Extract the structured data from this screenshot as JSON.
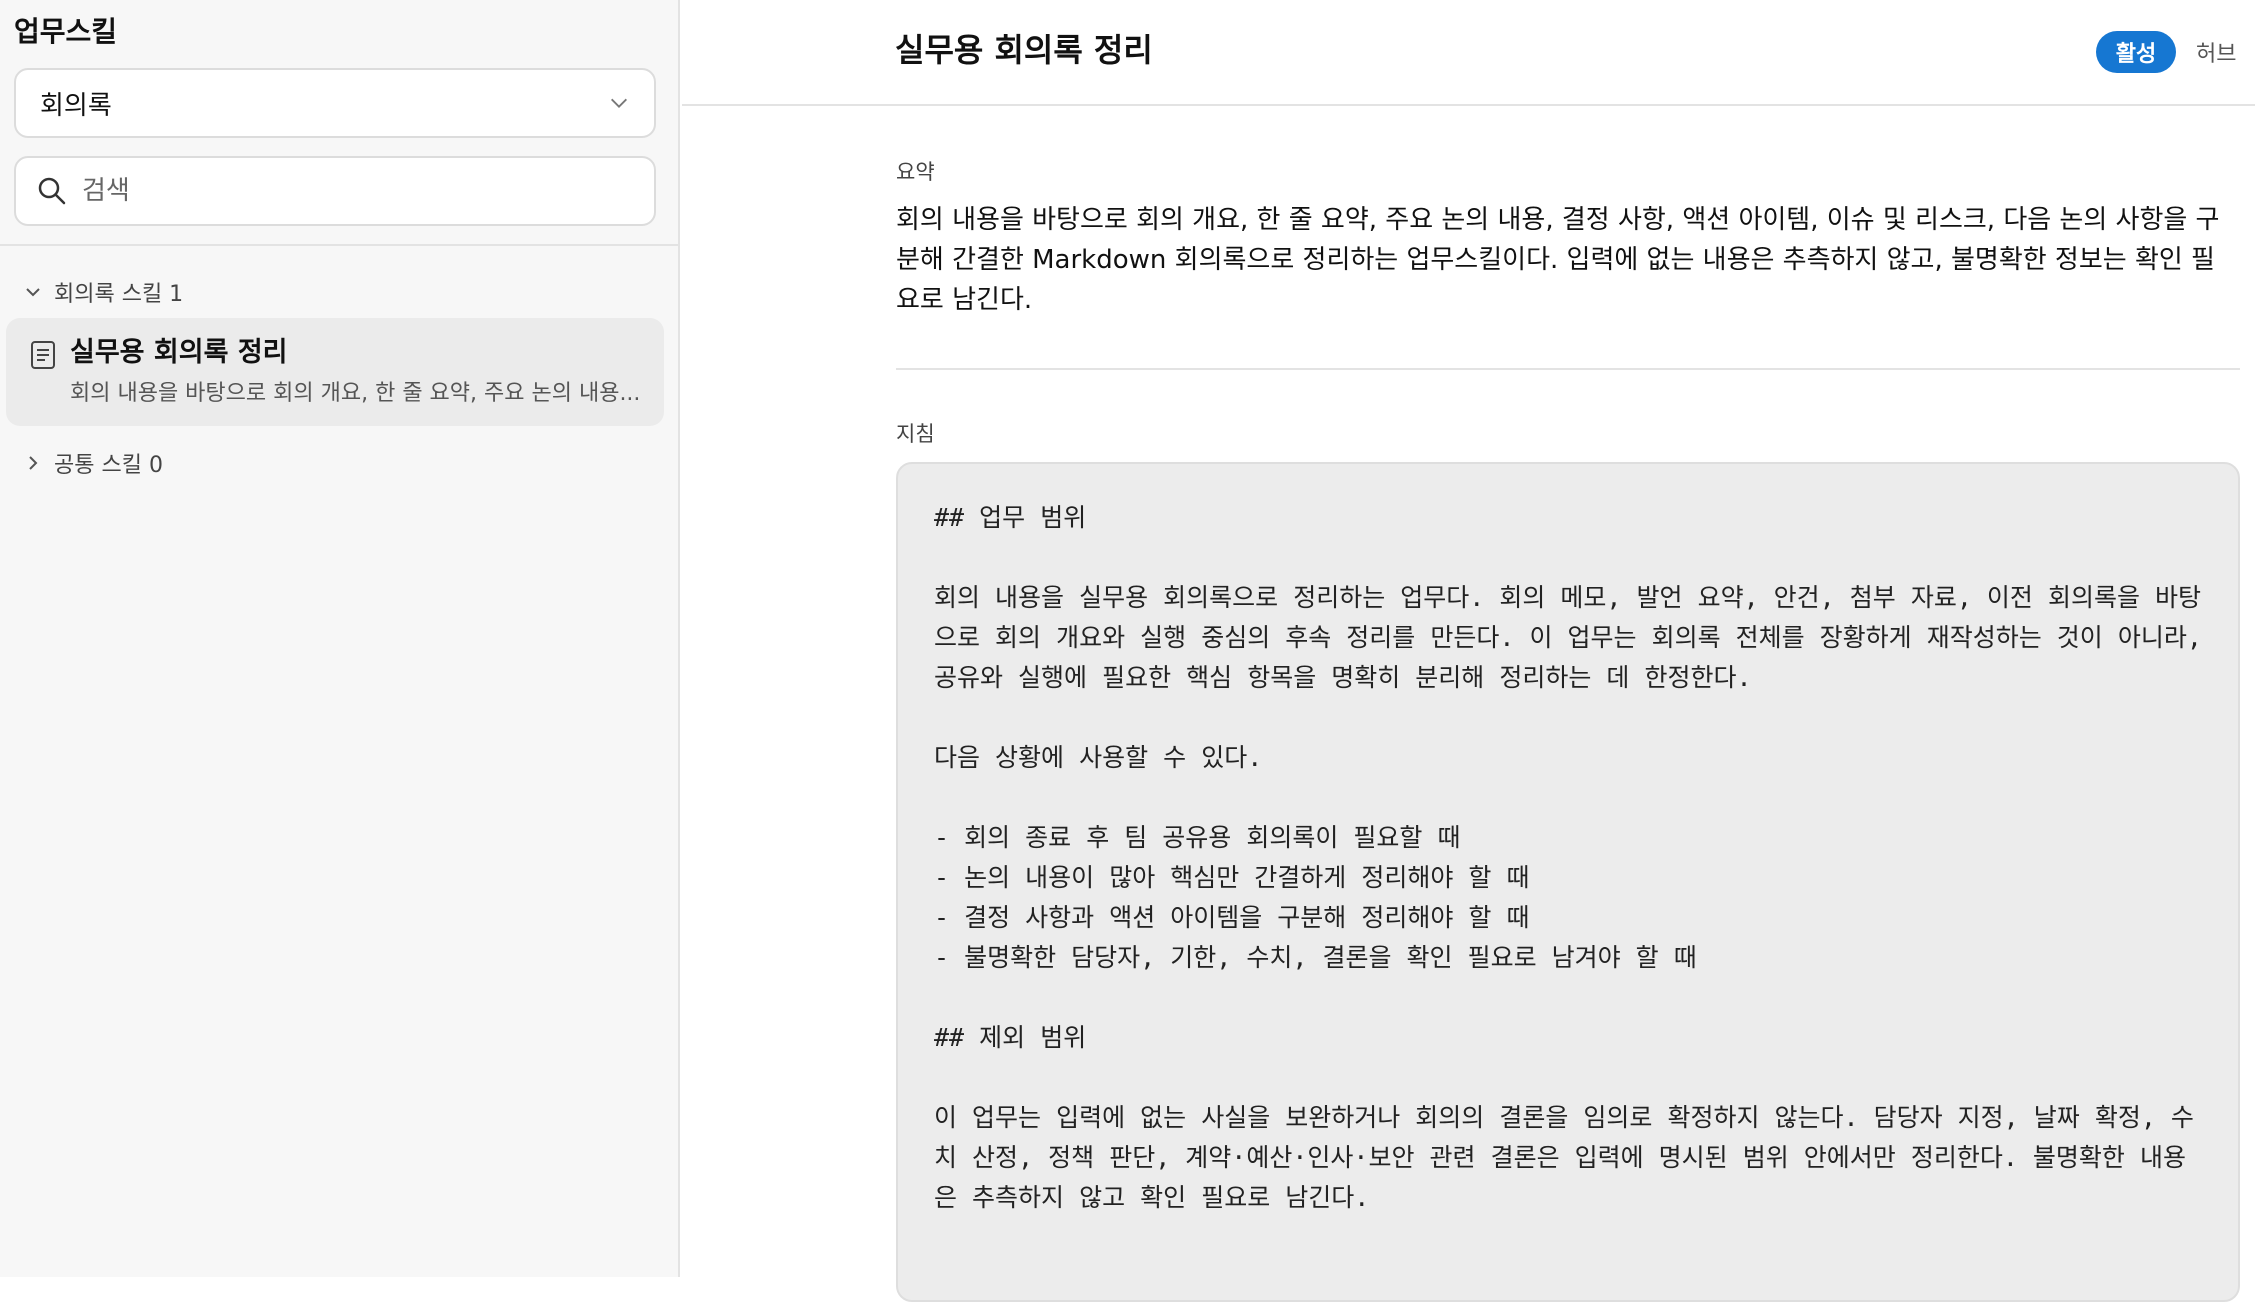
{
  "sidebar": {
    "app_title": "업무스킬",
    "category_select": {
      "value": "회의록"
    },
    "search": {
      "placeholder": "검색"
    },
    "groups": [
      {
        "label": "회의록 스킬 1",
        "expanded": true
      },
      {
        "label": "공통 스킬 0",
        "expanded": false
      }
    ],
    "skills": [
      {
        "name": "실무용 회의록 정리",
        "description": "회의 내용을 바탕으로 회의 개요, 한 줄 요약, 주요 논의 내용..."
      }
    ]
  },
  "header": {
    "title": "실무용 회의록 정리",
    "active_label": "활성",
    "hub_label": "허브"
  },
  "summary": {
    "label": "요약",
    "text": "회의 내용을 바탕으로 회의 개요, 한 줄 요약, 주요 논의 내용, 결정 사항, 액션 아이템, 이슈 및 리스크, 다음 논의 사항을 구분해 간결한 Markdown 회의록으로 정리하는 업무스킬이다. 입력에 없는 내용은 추측하지 않고, 불명확한 정보는 확인 필요로 남긴다."
  },
  "guide": {
    "label": "지침",
    "text": "## 업무 범위\n\n회의 내용을 실무용 회의록으로 정리하는 업무다. 회의 메모, 발언 요약, 안건, 첨부 자료, 이전 회의록을 바탕으로 회의 개요와 실행 중심의 후속 정리를 만든다. 이 업무는 회의록 전체를 장황하게 재작성하는 것이 아니라, 공유와 실행에 필요한 핵심 항목을 명확히 분리해 정리하는 데 한정한다.\n\n다음 상황에 사용할 수 있다.\n\n- 회의 종료 후 팀 공유용 회의록이 필요할 때\n- 논의 내용이 많아 핵심만 간결하게 정리해야 할 때\n- 결정 사항과 액션 아이템을 구분해 정리해야 할 때\n- 불명확한 담당자, 기한, 수치, 결론을 확인 필요로 남겨야 할 때\n\n## 제외 범위\n\n이 업무는 입력에 없는 사실을 보완하거나 회의의 결론을 임의로 확정하지 않는다. 담당자 지정, 날짜 확정, 수치 산정, 정책 판단, 계약·예산·인사·보안 관련 결론은 입력에 명시된 범위 안에서만 정리한다. 불명확한 내용은 추측하지 않고 확인 필요로 남긴다."
  },
  "colors": {
    "accent": "#1677d2",
    "sidebar_bg": "#f7f7f7",
    "selected_bg": "#ebebeb",
    "guide_bg": "#ececec"
  }
}
